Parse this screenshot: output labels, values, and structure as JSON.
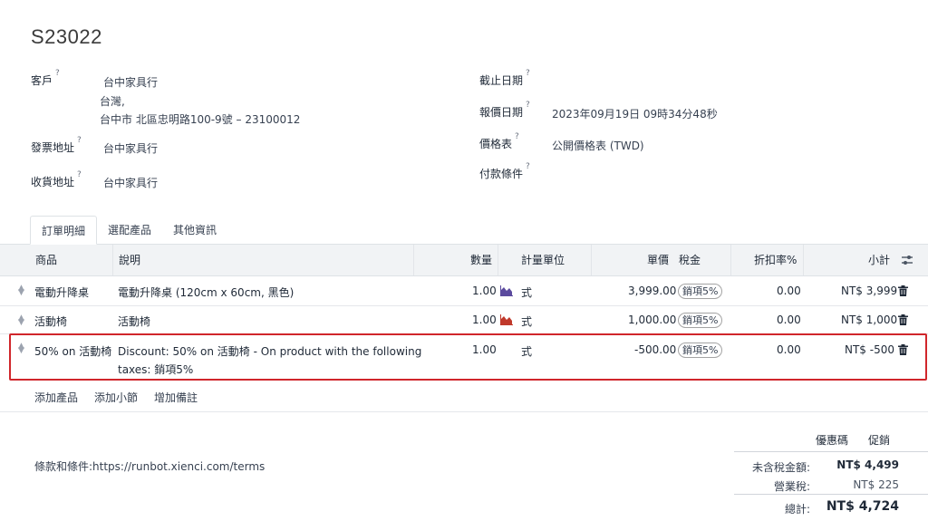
{
  "record": {
    "name": "S23022"
  },
  "fields": {
    "customer": {
      "label": "客戶",
      "value_line1": "台中家具行",
      "value_line2": "台灣,",
      "value_line3": "台中市 北區忠明路100-9號 – 23100012"
    },
    "invoice_address": {
      "label": "發票地址",
      "value": "台中家具行"
    },
    "delivery_address": {
      "label": "收貨地址",
      "value": "台中家具行"
    },
    "expiration": {
      "label": "截止日期",
      "value": ""
    },
    "quotation_date": {
      "label": "報價日期",
      "value": "2023年09月19日 09時34分48秒"
    },
    "pricelist": {
      "label": "價格表",
      "value": "公開價格表 (TWD)"
    },
    "payment_terms": {
      "label": "付款條件",
      "value": ""
    },
    "help_mark": "?"
  },
  "tabs": [
    {
      "label": "訂單明細",
      "active": true
    },
    {
      "label": "選配產品",
      "active": false
    },
    {
      "label": "其他資訊",
      "active": false
    }
  ],
  "table": {
    "headers": {
      "product": "商品",
      "description": "說明",
      "quantity": "數量",
      "uom": "計量單位",
      "unit_price": "單價",
      "taxes": "稅金",
      "discount": "折扣率%",
      "subtotal": "小計"
    },
    "rows": [
      {
        "product": "電動升降桌",
        "description": "電動升降桌 (120cm x 60cm, 黑色)",
        "description2": "",
        "quantity": "1.00",
        "forecast_icon": "forecast-chart-icon",
        "forecast_color": "#5b4a9e",
        "uom": "式",
        "unit_price": "3,999.00",
        "tax": "銷項5%",
        "discount": "0.00",
        "subtotal": "NT$ 3,999"
      },
      {
        "product": "活動椅",
        "description": "活動椅",
        "description2": "",
        "quantity": "1.00",
        "forecast_icon": "forecast-chart-icon",
        "forecast_color": "#c0392b",
        "uom": "式",
        "unit_price": "1,000.00",
        "tax": "銷項5%",
        "discount": "0.00",
        "subtotal": "NT$ 1,000"
      },
      {
        "product": "50% on 活動椅",
        "description": "Discount: 50% on 活動椅 - On product with the following",
        "description2": "taxes: 銷項5%",
        "quantity": "1.00",
        "forecast_icon": "",
        "forecast_color": "",
        "uom": "式",
        "unit_price": "-500.00",
        "tax": "銷項5%",
        "discount": "0.00",
        "subtotal": "NT$ -500"
      }
    ]
  },
  "actions": {
    "add_product": "添加產品",
    "add_section": "添加小節",
    "add_note": "增加備註"
  },
  "terms": "條款和條件:https://runbot.xienci.com/terms",
  "promo": {
    "coupon": "優惠碼",
    "promotion": "促銷"
  },
  "totals": {
    "untaxed_label": "未含稅金額:",
    "untaxed_value": "NT$ 4,499",
    "tax_label": "營業稅:",
    "tax_value": "NT$ 225",
    "total_label": "總計:",
    "total_value": "NT$ 4,724"
  },
  "colors": {
    "highlight": "#d0262b",
    "header_bg": "#f1f3f5"
  }
}
